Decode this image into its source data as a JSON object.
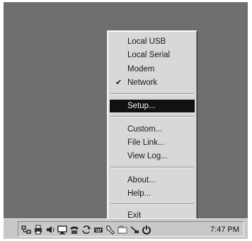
{
  "menu": {
    "items": [
      {
        "label": "Local USB"
      },
      {
        "label": "Local Serial"
      },
      {
        "label": "Modem"
      },
      {
        "label": "Network",
        "check": "✔"
      },
      {
        "label": "Setup..."
      },
      {
        "label": "Custom..."
      },
      {
        "label": "File Link..."
      },
      {
        "label": "View Log..."
      },
      {
        "label": "About..."
      },
      {
        "label": "Help..."
      },
      {
        "label": "Exit"
      }
    ],
    "selected_index": 4
  },
  "taskbar": {
    "clock": "7:47 PM",
    "tray_icons": [
      "network-icon",
      "printer-icon",
      "speaker-icon",
      "monitor-icon",
      "phone-icon",
      "sync-icon",
      "keyboard-icon",
      "mouse-icon",
      "folder-icon",
      "scanner-icon",
      "power-icon"
    ]
  }
}
